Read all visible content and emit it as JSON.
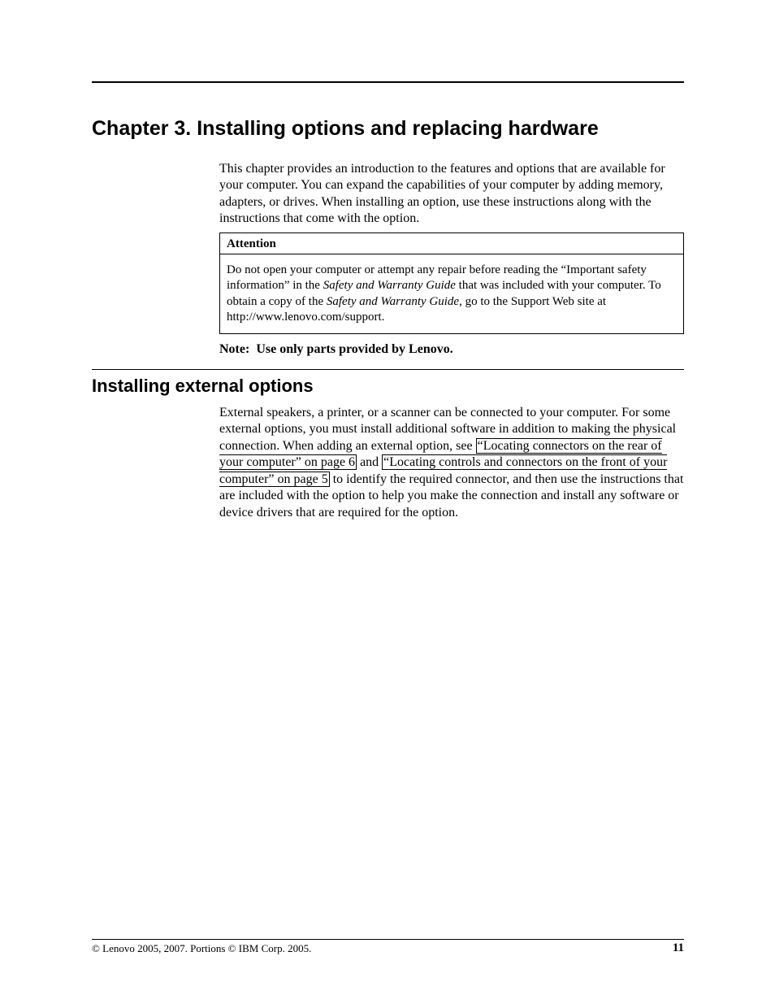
{
  "chapter_title": "Chapter 3. Installing options and replacing hardware",
  "intro": "This chapter provides an introduction to the features and options that are available for your computer. You can expand the capabilities of your computer by adding memory, adapters, or drives. When installing an option, use these instructions along with the instructions that come with the option.",
  "attention": {
    "header": "Attention",
    "p1a": "Do not open your computer or attempt any repair before reading the “Important safety information” in the ",
    "p1b_italic": "Safety and Warranty Guide",
    "p1c": " that was included with your computer. To obtain a copy of the ",
    "p1d_italic": "Safety and Warranty Guide",
    "p1e": ", go to the Support Web site at http://www.lenovo.com/support."
  },
  "note": {
    "label": "Note:",
    "text": "Use only parts provided by Lenovo."
  },
  "section_title": "Installing external options",
  "section_body": {
    "a": "External speakers, a printer, or a scanner can be connected to your computer. For some external options, you must install additional software in addition to making the physical connection. When adding an external option, see ",
    "xref1": "“Locating connectors on the rear of your computer” on page 6",
    "b": " and ",
    "xref2": "“Locating controls and connectors on the front of your computer” on page 5",
    "c": " to identify the required connector, and then use the instructions that are included with the option to help you make the connection and install any software or device drivers that are required for the option."
  },
  "footer": {
    "copyright": "© Lenovo 2005, 2007. Portions © IBM Corp. 2005.",
    "page_number": "11"
  }
}
